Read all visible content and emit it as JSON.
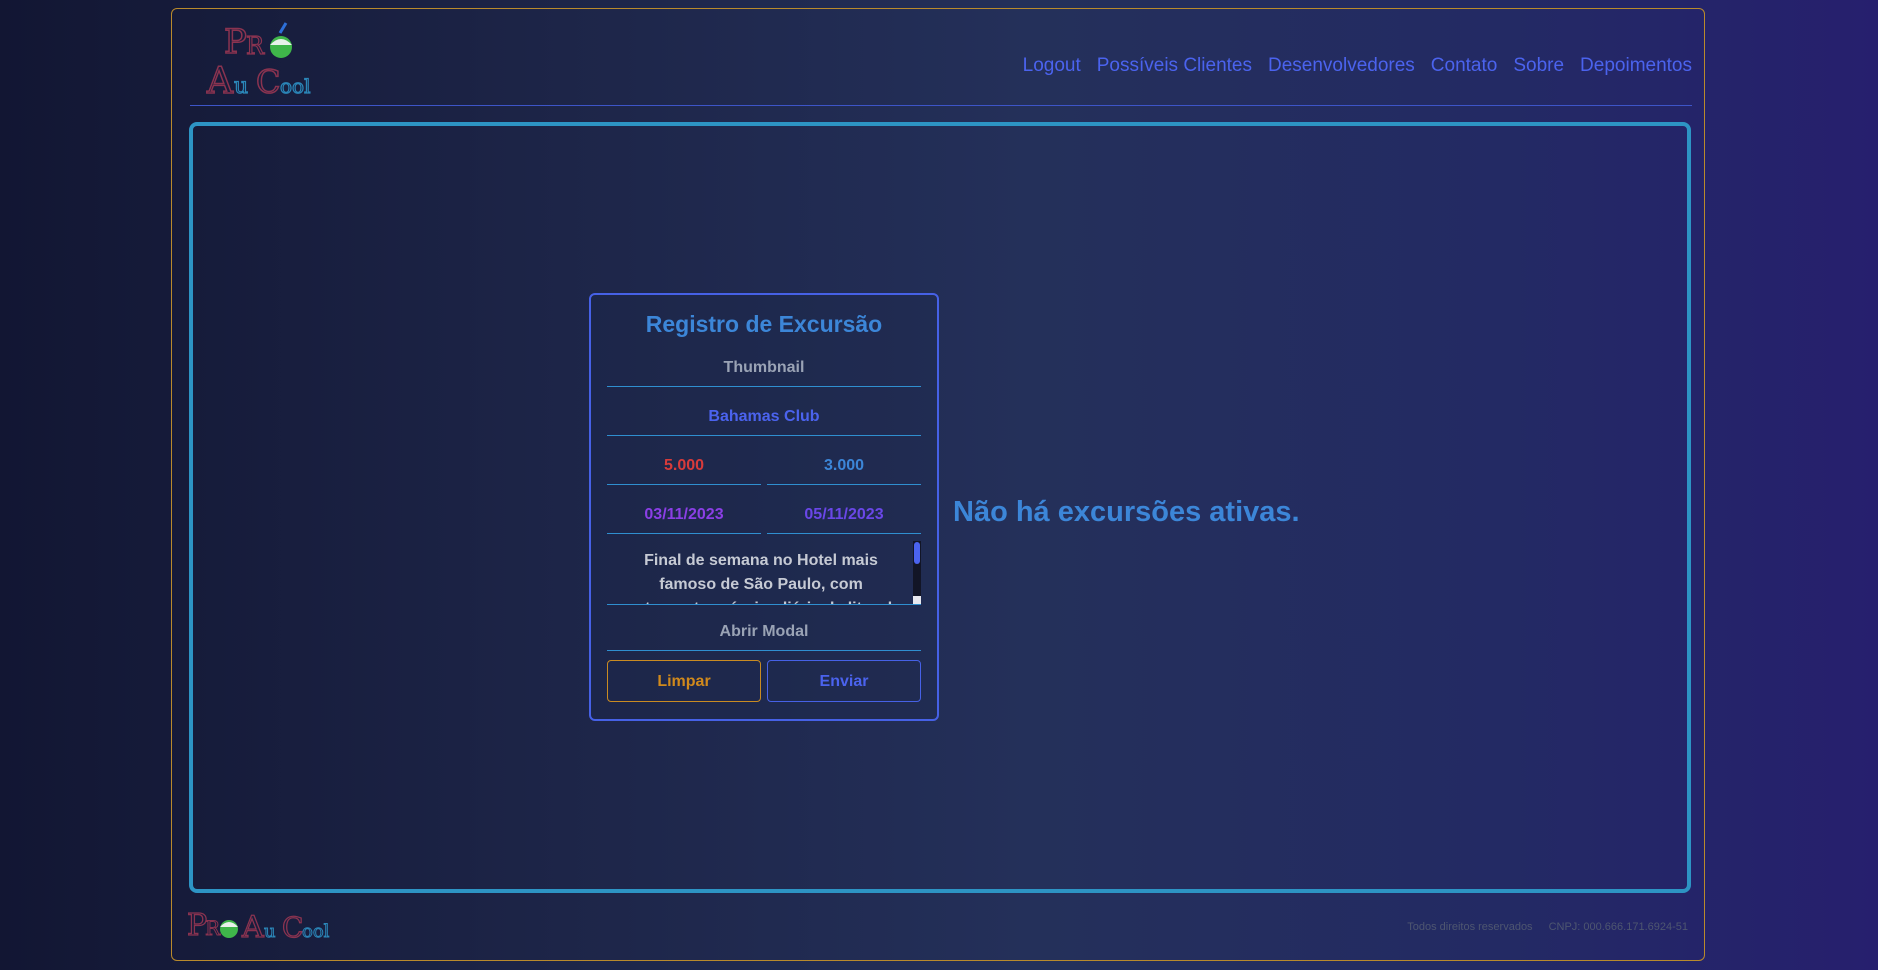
{
  "header": {
    "logo_alt": "ProAuCool",
    "nav": [
      "Logout",
      "Possíveis Clientes",
      "Desenvolvedores",
      "Contato",
      "Sobre",
      "Depoimentos"
    ]
  },
  "form": {
    "title": "Registro de Excursão",
    "thumbnail_label": "Thumbnail",
    "name_value": "Bahamas Club",
    "price_value": "5.000",
    "price2_value": "3.000",
    "start_date": "03/11/2023",
    "end_date": "05/11/2023",
    "description": "Final de semana no Hotel mais famoso de São Paulo, com restaurante próprio, diária de litro de cerveja",
    "modal_label": "Abrir Modal",
    "clear_label": "Limpar",
    "send_label": "Enviar"
  },
  "main": {
    "empty_message": "Não há excursões ativas."
  },
  "footer": {
    "rights": "Todos direitos reservados",
    "cnpj": "CNPJ: 000.666.171.6924-51"
  },
  "colors": {
    "accent_blue": "#4b63ee",
    "title_blue": "#3c86d8",
    "orange": "#c98b22",
    "red": "#d83b3b",
    "purple": "#8b3fe6"
  }
}
